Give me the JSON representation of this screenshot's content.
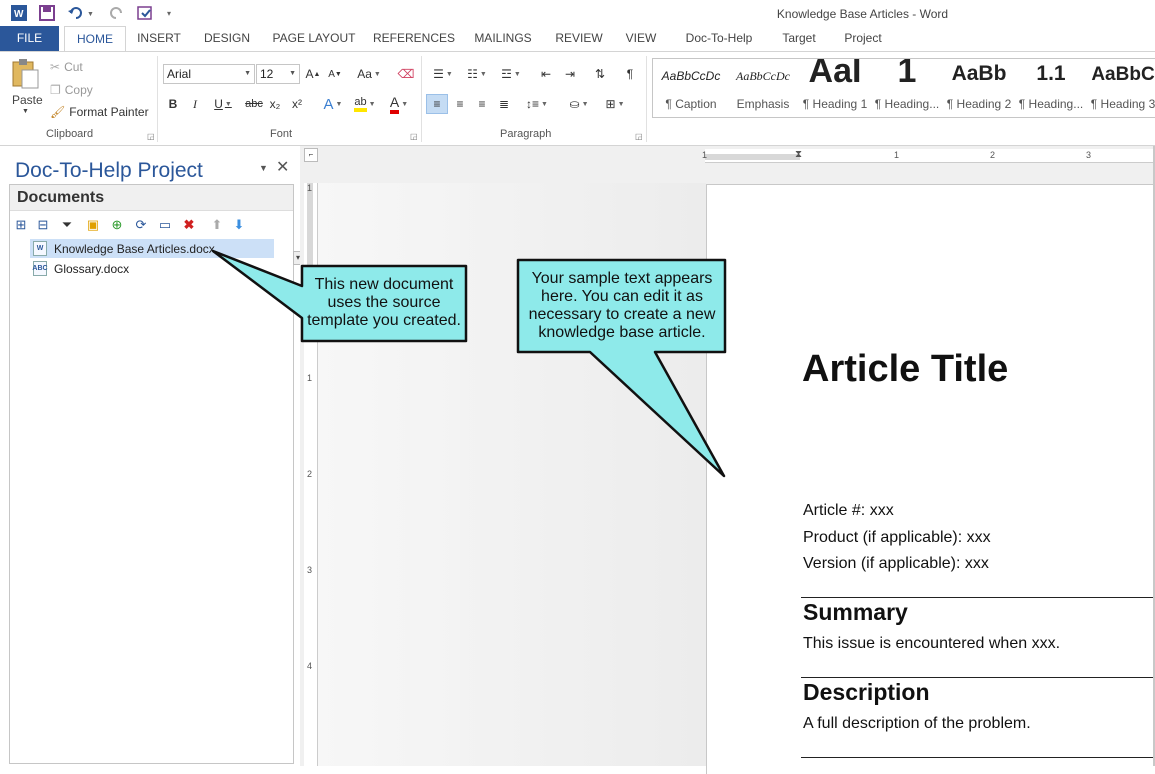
{
  "window": {
    "title": "Knowledge Base Articles - Word"
  },
  "quick_access": {
    "word_icon": "word-app-icon",
    "save_icon": "save-icon",
    "undo_icon": "undo-icon",
    "redo_icon": "redo-icon",
    "touch_icon": "touch-mode-icon",
    "more_icon": "customize-qat-icon"
  },
  "tabs": [
    "FILE",
    "HOME",
    "INSERT",
    "DESIGN",
    "PAGE LAYOUT",
    "REFERENCES",
    "MAILINGS",
    "REVIEW",
    "VIEW",
    "Doc-To-Help",
    "Target",
    "Project"
  ],
  "ribbon": {
    "clipboard": {
      "label": "Clipboard",
      "paste": "Paste",
      "cut": "Cut",
      "copy": "Copy",
      "format_painter": "Format Painter"
    },
    "font": {
      "label": "Font",
      "family": "Arial",
      "size": "12",
      "grow": "A",
      "shrink": "A",
      "case": "Aa",
      "bold": "B",
      "italic": "I",
      "underline": "U",
      "strike": "abc",
      "subscript": "x₂",
      "superscript": "x²",
      "effects": "A",
      "highlight": "ab",
      "color": "A"
    },
    "paragraph": {
      "label": "Paragraph",
      "pilcrow": "¶"
    },
    "styles": [
      {
        "preview": "AaBbCcDc",
        "name": "¶ Caption"
      },
      {
        "preview": "AaBbCcDc",
        "name": "Emphasis"
      },
      {
        "preview": "AaI",
        "name": "¶ Heading 1"
      },
      {
        "preview": "1",
        "name": "¶ Heading..."
      },
      {
        "preview": "AaBb",
        "name": "¶ Heading 2"
      },
      {
        "preview": "1.1",
        "name": "¶ Heading..."
      },
      {
        "preview": "AaBbC",
        "name": "¶ Heading 3"
      }
    ]
  },
  "pane": {
    "title": "Doc-To-Help Project",
    "section": "Documents",
    "files": [
      {
        "name": "Knowledge Base Articles.docx",
        "selected": true,
        "icon": "word-doc-icon"
      },
      {
        "name": "Glossary.docx",
        "selected": false,
        "icon": "glossary-doc-icon"
      }
    ]
  },
  "callouts": {
    "left": "This new document uses the source template you created.",
    "right": "Your sample text appears here. You can edit it as necessary to create a new knowledge base article."
  },
  "document": {
    "title": "Article Title",
    "article_no": "Article #: xxx",
    "product": "Product (if applicable): xxx",
    "version": "Version (if applicable): xxx",
    "summary_heading": "Summary",
    "summary_text": "This issue is encountered when xxx.",
    "description_heading": "Description",
    "description_text": "A full description of the problem."
  },
  "rulers": {
    "h_numbers": [
      "1",
      "1",
      "2",
      "3"
    ],
    "v_numbers": [
      "1",
      "1",
      "2",
      "3",
      "4"
    ]
  },
  "colors": {
    "accent": "#2b579a",
    "callout_fill": "#8eeaea",
    "selection": "#cce0f7"
  }
}
